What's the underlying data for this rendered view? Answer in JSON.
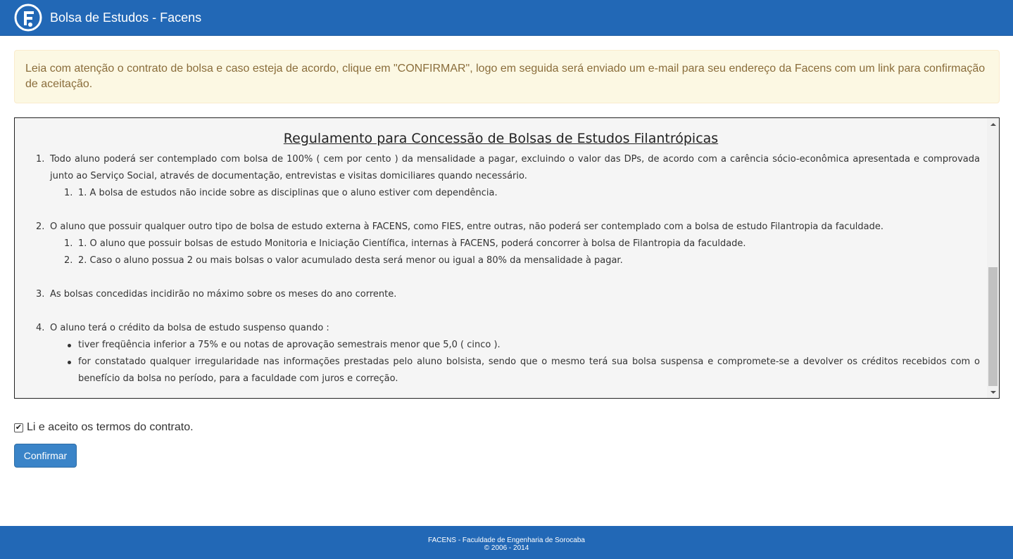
{
  "header": {
    "title": "Bolsa de Estudos - Facens",
    "logo_icon": "facens-logo-icon"
  },
  "alert": {
    "text": "Leia com atenção o contrato de bolsa e caso esteja de acordo, clique em \"CONFIRMAR\", logo em seguida será enviado um e-mail para seu endereço da Facens com um link para confirmação de aceitação."
  },
  "contract": {
    "title": "Regulamento para Concessão de Bolsas de Estudos Filantrópicas",
    "items": [
      {
        "num": "1.",
        "text": "Todo aluno poderá ser contemplado com bolsa de 100% ( cem por cento ) da mensalidade a pagar, excluindo o valor das DPs, de acordo com a carência sócio-econômica apresentada e comprovada junto ao Serviço Social, através de documentação, entrevistas e visitas domiciliares quando necessário.",
        "sub": [
          {
            "num": "1.",
            "text": "1. A bolsa de estudos não incide sobre as disciplinas que o aluno estiver com dependência."
          }
        ]
      },
      {
        "num": "2.",
        "text": "O aluno que possuir qualquer outro tipo de bolsa de estudo externa à FACENS, como FIES, entre outras, não poderá ser contemplado com a bolsa de estudo Filantropia da faculdade.",
        "sub": [
          {
            "num": "1.",
            "text": "1. O aluno que possuir bolsas de estudo Monitoria e Iniciação Científica, internas à FACENS, poderá concorrer à bolsa de Filantropia da faculdade."
          },
          {
            "num": "2.",
            "text": "2. Caso o aluno possua 2 ou mais bolsas o valor acumulado desta será menor ou igual a 80% da mensalidade à pagar."
          }
        ]
      },
      {
        "num": "3.",
        "text": "As bolsas concedidas incidirão no máximo sobre os meses do ano corrente."
      },
      {
        "num": "4.",
        "text": "O aluno terá o crédito da bolsa de estudo suspenso quando :",
        "bullets": [
          "tiver freqüência inferior a 75% e ou notas de aprovação semestrais menor que 5,0 ( cinco ).",
          "for constatado qualquer irregularidade nas informações prestadas pelo aluno bolsista, sendo que o mesmo terá sua bolsa suspensa e compromete-se a devolver os créditos recebidos com o benefício da bolsa no período, para a faculdade com juros e correção."
        ]
      }
    ]
  },
  "agree": {
    "label": "Li e aceito os termos do contrato.",
    "checked": true,
    "check_glyph": "✔"
  },
  "confirm_button": {
    "label": "Confirmar"
  },
  "footer": {
    "line1": "FACENS - Faculdade de Engenharia de Sorocaba",
    "line2": "© 2006 - 2014"
  },
  "colors": {
    "brand_blue": "#2268b6",
    "button_blue": "#3a84c8",
    "alert_bg": "#fcf8e3",
    "alert_text": "#8a6d3b"
  }
}
